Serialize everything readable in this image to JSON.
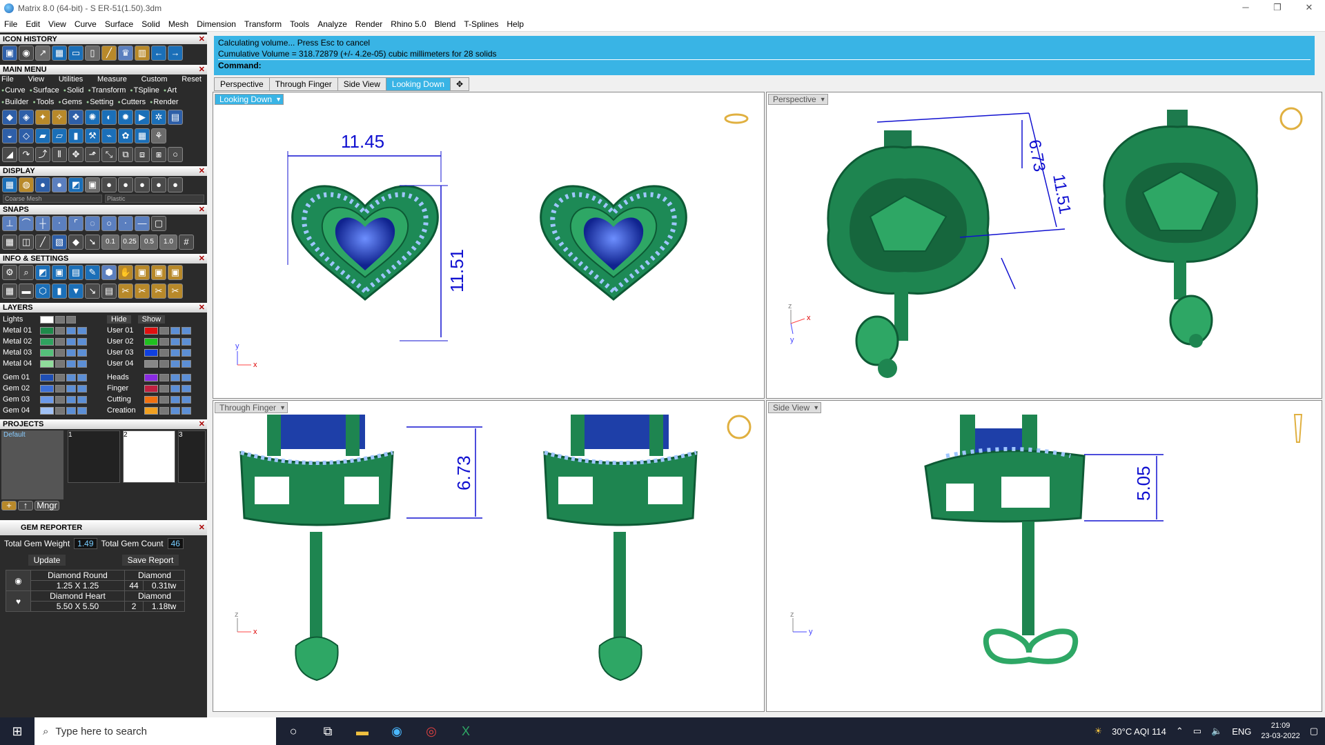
{
  "window": {
    "title": "Matrix 8.0 (64-bit) - S ER-51(1.50).3dm"
  },
  "menubar": [
    "File",
    "Edit",
    "View",
    "Curve",
    "Surface",
    "Solid",
    "Mesh",
    "Dimension",
    "Transform",
    "Tools",
    "Analyze",
    "Render",
    "Rhino 5.0",
    "Blend",
    "T-Splines",
    "Help"
  ],
  "left_panel": {
    "icon_history": "ICON HISTORY",
    "main_menu": {
      "title": "MAIN MENU",
      "tabs": [
        "File",
        "View",
        "Utilities",
        "Measure",
        "Custom"
      ],
      "reset": "Reset",
      "row1": [
        "Curve",
        "Surface",
        "Solid",
        "Transform",
        "TSpline",
        "Art"
      ],
      "row2": [
        "Builder",
        "Tools",
        "Gems",
        "Setting",
        "Cutters",
        "Render"
      ]
    },
    "display": {
      "title": "DISPLAY",
      "dd1": "Coarse Mesh",
      "dd2": "Plastic"
    },
    "snaps": {
      "title": "SNAPS",
      "values": [
        "0.1",
        "0.25",
        "0.5",
        "1.0"
      ]
    },
    "info": "INFO & SETTINGS",
    "layers": {
      "title": "LAYERS",
      "lights": "Lights",
      "hide": "Hide",
      "show": "Show",
      "left": [
        {
          "n": "Metal 01",
          "c": "#1e8a4a"
        },
        {
          "n": "Metal 02",
          "c": "#2fa35f"
        },
        {
          "n": "Metal 03",
          "c": "#55c07a"
        },
        {
          "n": "Metal 04",
          "c": "#8fdc9b"
        },
        {
          "n": "Gem 01",
          "c": "#1f4fb5"
        },
        {
          "n": "Gem 02",
          "c": "#3c6fd6"
        },
        {
          "n": "Gem 03",
          "c": "#6b99ea"
        },
        {
          "n": "Gem 04",
          "c": "#9fc0f5"
        }
      ],
      "right": [
        {
          "n": "User 01",
          "c": "#e01010"
        },
        {
          "n": "User 02",
          "c": "#20c020"
        },
        {
          "n": "User 03",
          "c": "#1040e0"
        },
        {
          "n": "User 04",
          "c": "#888888"
        },
        {
          "n": "Heads",
          "c": "#8a2be2"
        },
        {
          "n": "Finger",
          "c": "#c02040"
        },
        {
          "n": "Cutting",
          "c": "#f07010"
        },
        {
          "n": "Creation",
          "c": "#f0a020"
        }
      ]
    },
    "projects": {
      "title": "PROJECTS",
      "default": "Default",
      "pages": [
        "1",
        "2",
        "3"
      ],
      "mngr": "Mngr"
    },
    "gem_reporter": {
      "title": "GEM REPORTER",
      "weight_label": "Total Gem Weight",
      "weight": "1.49",
      "count_label": "Total Gem Count",
      "count": "46",
      "update": "Update",
      "save": "Save Report",
      "gems": [
        {
          "shape": "Diamond Round",
          "mat": "Diamond",
          "size": "1.25 X 1.25",
          "qty": "44",
          "tw": "0.31tw"
        },
        {
          "shape": "Diamond Heart",
          "mat": "Diamond",
          "size": "5.50 X 5.50",
          "qty": "2",
          "tw": "1.18tw"
        }
      ]
    }
  },
  "command": {
    "line1": "Calculating volume... Press Esc to cancel",
    "line2": "Cumulative Volume = 318.72879 (+/- 4.2e-05) cubic millimeters for 28 solids",
    "prompt": "Command:"
  },
  "view_tabs": [
    "Perspective",
    "Through Finger",
    "Side View",
    "Looking Down"
  ],
  "viewports": {
    "looking_down": "Looking Down",
    "perspective": "Perspective",
    "through_finger": "Through Finger",
    "side_view": "Side View"
  },
  "dimensions": {
    "d1": "11.45",
    "d2": "11.51",
    "d3": "6.73",
    "d4": "11.51",
    "d5": "6.73",
    "d6": "5.05"
  },
  "axes": {
    "x": "x",
    "y": "y",
    "z": "z"
  },
  "taskbar": {
    "search": "Type here to search",
    "weather": "30°C  AQI 114",
    "lang": "ENG",
    "time": "21:09",
    "date": "23-03-2022"
  }
}
